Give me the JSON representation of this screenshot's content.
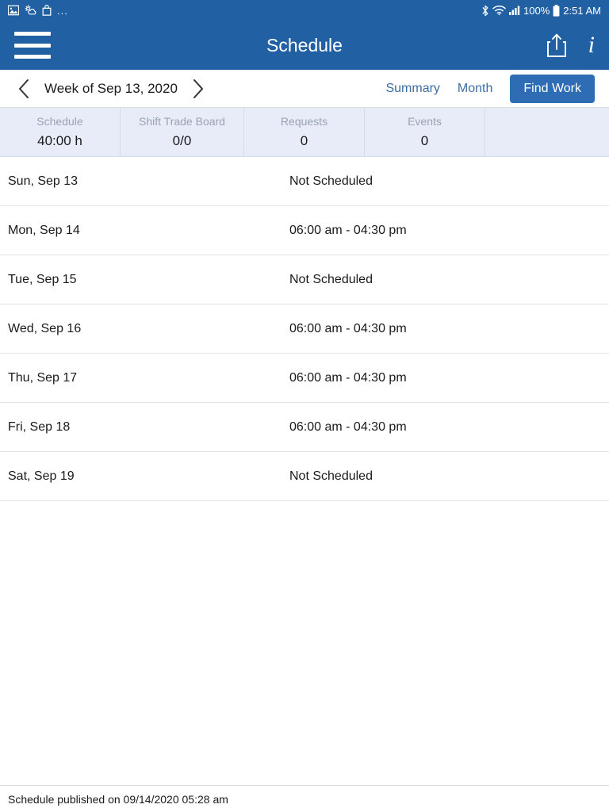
{
  "status_bar": {
    "left_icons": [
      "image-icon",
      "weather-icon",
      "bag-icon"
    ],
    "overflow": "...",
    "right_icons": [
      "bluetooth-icon",
      "wifi-icon",
      "cellular-signal-icon",
      "battery-icon"
    ],
    "battery_percent": "100%",
    "time": "2:51 AM"
  },
  "header": {
    "menu_icon": "hamburger-menu-icon",
    "title": "Schedule",
    "share_icon": "share-icon",
    "info_icon": "info-icon"
  },
  "week_nav": {
    "prev_icon": "chevron-left-icon",
    "label": "Week of Sep 13, 2020",
    "next_icon": "chevron-right-icon",
    "summary_label": "Summary",
    "month_label": "Month",
    "find_work_label": "Find Work"
  },
  "stats": [
    {
      "label": "Schedule",
      "value": "40:00 h"
    },
    {
      "label": "Shift Trade Board",
      "value": "0/0"
    },
    {
      "label": "Requests",
      "value": "0"
    },
    {
      "label": "Events",
      "value": "0"
    }
  ],
  "schedule_rows": [
    {
      "day": "Sun, Sep 13",
      "time": "Not Scheduled"
    },
    {
      "day": "Mon, Sep 14",
      "time": "06:00 am - 04:30 pm"
    },
    {
      "day": "Tue, Sep 15",
      "time": "Not Scheduled"
    },
    {
      "day": "Wed, Sep 16",
      "time": "06:00 am - 04:30 pm"
    },
    {
      "day": "Thu, Sep 17",
      "time": "06:00 am - 04:30 pm"
    },
    {
      "day": "Fri, Sep 18",
      "time": "06:00 am - 04:30 pm"
    },
    {
      "day": "Sat, Sep 19",
      "time": "Not Scheduled"
    }
  ],
  "footer": {
    "published_text": "Schedule published on 09/14/2020 05:28 am"
  },
  "colors": {
    "header_blue": "#2260a4",
    "button_blue": "#2e6cb4",
    "link_blue": "#3b6ea5",
    "stats_bg": "#e7ecf8",
    "muted_text": "#9aa3b0"
  }
}
